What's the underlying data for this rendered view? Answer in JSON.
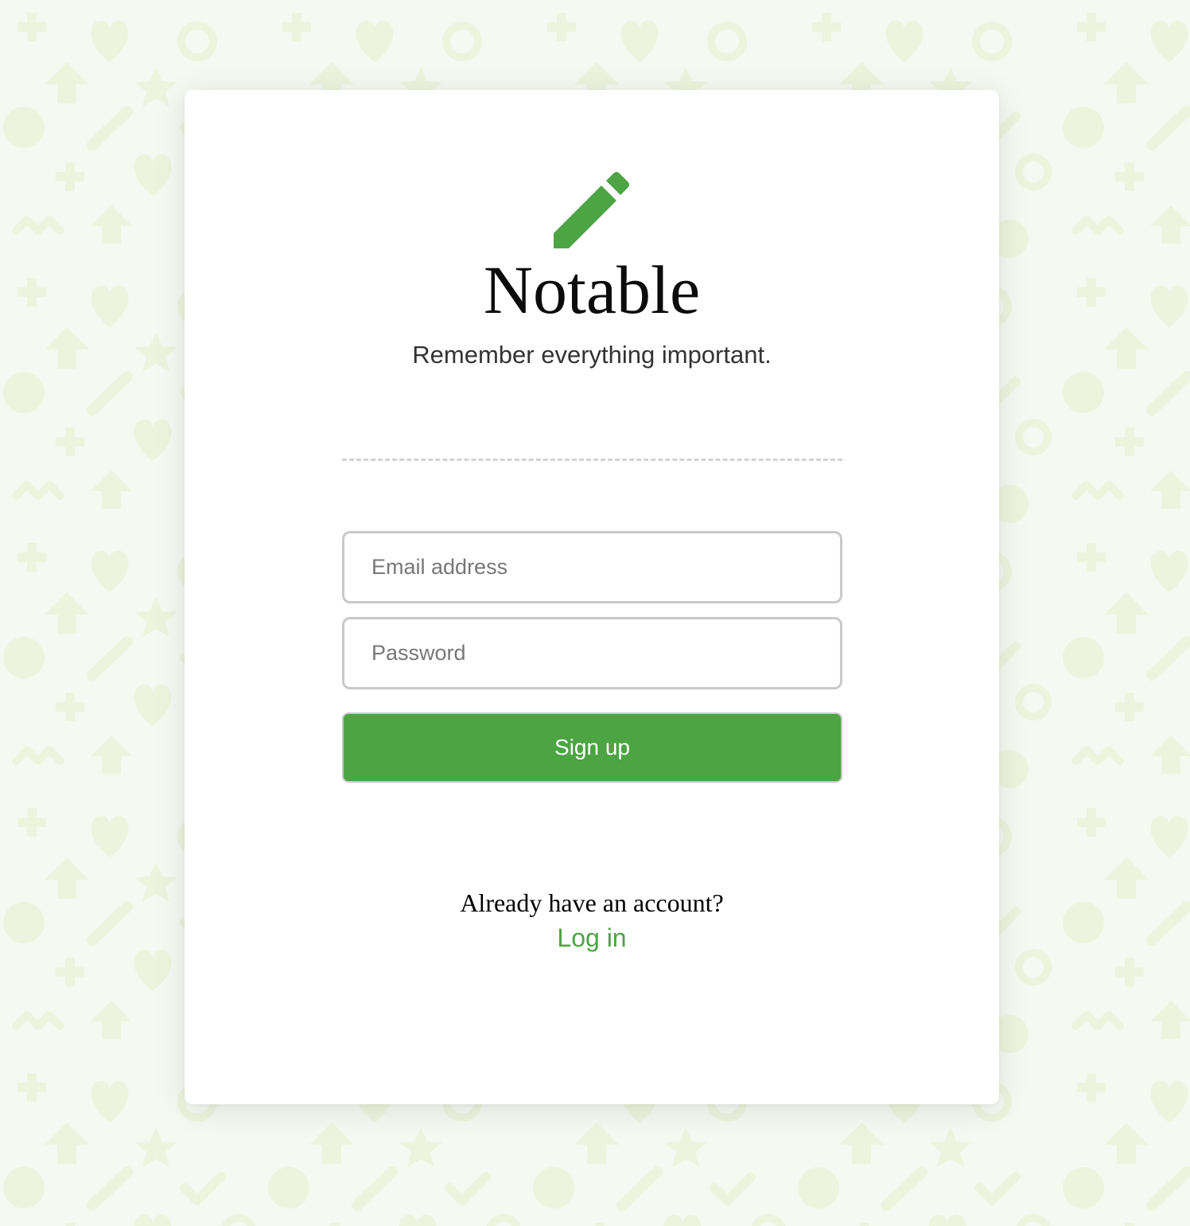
{
  "app": {
    "brand_name": "Notable",
    "tagline": "Remember everything important.",
    "logo_icon": "pencil-icon"
  },
  "form": {
    "email_placeholder": "Email address",
    "email_value": "",
    "password_placeholder": "Password",
    "password_value": "",
    "submit_label": "Sign up"
  },
  "footer": {
    "prompt": "Already have an account?",
    "login_label": "Log in"
  },
  "colors": {
    "accent": "#4ca443",
    "background": "#f5f9f1",
    "pattern": "#edf4de",
    "card": "#ffffff"
  }
}
